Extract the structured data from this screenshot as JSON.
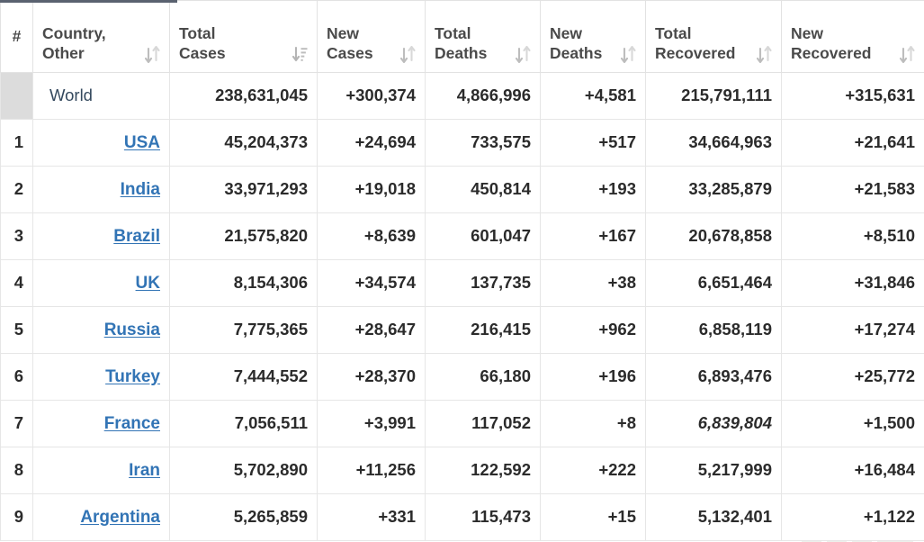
{
  "table": {
    "columns": [
      {
        "label": "#",
        "sort_icon": "none",
        "key": "rank"
      },
      {
        "label": "Country,\nOther",
        "sort_icon": "sort-icon",
        "key": "country"
      },
      {
        "label": "Total\nCases",
        "sort_icon": "sort-amount-down-icon",
        "key": "total_cases"
      },
      {
        "label": "New\nCases",
        "sort_icon": "sort-icon",
        "key": "new_cases"
      },
      {
        "label": "Total\nDeaths",
        "sort_icon": "sort-icon",
        "key": "total_deaths"
      },
      {
        "label": "New\nDeaths",
        "sort_icon": "sort-icon",
        "key": "new_deaths"
      },
      {
        "label": "Total\nRecovered",
        "sort_icon": "sort-icon",
        "key": "total_recovered"
      },
      {
        "label": "New\nRecovered",
        "sort_icon": "sort-icon",
        "key": "new_recovered"
      }
    ],
    "column_labels": {
      "rank": "#",
      "country_line1": "Country,",
      "country_line2": "Other",
      "total_cases_line1": "Total",
      "total_cases_line2": "Cases",
      "new_cases_line1": "New",
      "new_cases_line2": "Cases",
      "total_deaths_line1": "Total",
      "total_deaths_line2": "Deaths",
      "new_deaths_line1": "New",
      "new_deaths_line2": "Deaths",
      "total_recovered_line1": "Total",
      "total_recovered_line2": "Recovered",
      "new_recovered_line1": "New",
      "new_recovered_line2": "Recovered"
    },
    "world_row": {
      "rank": "",
      "country": "World",
      "total_cases": "238,631,045",
      "new_cases": "+300,374",
      "total_deaths": "4,866,996",
      "new_deaths": "+4,581",
      "total_recovered": "215,791,111",
      "new_recovered": "+315,631"
    },
    "rows": [
      {
        "rank": "1",
        "country": "USA",
        "total_cases": "45,204,373",
        "new_cases": "+24,694",
        "total_deaths": "733,575",
        "new_deaths": "+517",
        "total_recovered": "34,664,963",
        "recovered_estimated": false,
        "new_recovered": "+21,641"
      },
      {
        "rank": "2",
        "country": "India",
        "total_cases": "33,971,293",
        "new_cases": "+19,018",
        "total_deaths": "450,814",
        "new_deaths": "+193",
        "total_recovered": "33,285,879",
        "recovered_estimated": false,
        "new_recovered": "+21,583"
      },
      {
        "rank": "3",
        "country": "Brazil",
        "total_cases": "21,575,820",
        "new_cases": "+8,639",
        "total_deaths": "601,047",
        "new_deaths": "+167",
        "total_recovered": "20,678,858",
        "recovered_estimated": false,
        "new_recovered": "+8,510"
      },
      {
        "rank": "4",
        "country": "UK",
        "total_cases": "8,154,306",
        "new_cases": "+34,574",
        "total_deaths": "137,735",
        "new_deaths": "+38",
        "total_recovered": "6,651,464",
        "recovered_estimated": false,
        "new_recovered": "+31,846"
      },
      {
        "rank": "5",
        "country": "Russia",
        "total_cases": "7,775,365",
        "new_cases": "+28,647",
        "total_deaths": "216,415",
        "new_deaths": "+962",
        "total_recovered": "6,858,119",
        "recovered_estimated": false,
        "new_recovered": "+17,274"
      },
      {
        "rank": "6",
        "country": "Turkey",
        "total_cases": "7,444,552",
        "new_cases": "+28,370",
        "total_deaths": "66,180",
        "new_deaths": "+196",
        "total_recovered": "6,893,476",
        "recovered_estimated": false,
        "new_recovered": "+25,772"
      },
      {
        "rank": "7",
        "country": "France",
        "total_cases": "7,056,511",
        "new_cases": "+3,991",
        "total_deaths": "117,052",
        "new_deaths": "+8",
        "total_recovered": "6,839,804",
        "recovered_estimated": true,
        "new_recovered": "+1,500"
      },
      {
        "rank": "8",
        "country": "Iran",
        "total_cases": "5,702,890",
        "new_cases": "+11,256",
        "total_deaths": "122,592",
        "new_deaths": "+222",
        "total_recovered": "5,217,999",
        "recovered_estimated": false,
        "new_recovered": "+16,484"
      },
      {
        "rank": "9",
        "country": "Argentina",
        "total_cases": "5,265,859",
        "new_cases": "+331",
        "total_deaths": "115,473",
        "new_deaths": "+15",
        "total_recovered": "5,132,401",
        "recovered_estimated": false,
        "new_recovered": "+1,122"
      }
    ]
  },
  "watermark": {
    "line1": "exmoor",
    "line2": "news"
  },
  "colors": {
    "new_cases_highlight": "#fde8a4",
    "new_deaths_highlight": "#ff0000",
    "new_recovered_highlight": "#c9e4c8",
    "world_row_bg": "#dcdcdc",
    "link": "#3274b5",
    "header_text": "#4a4a4a",
    "top_accent": "#5a6270"
  }
}
